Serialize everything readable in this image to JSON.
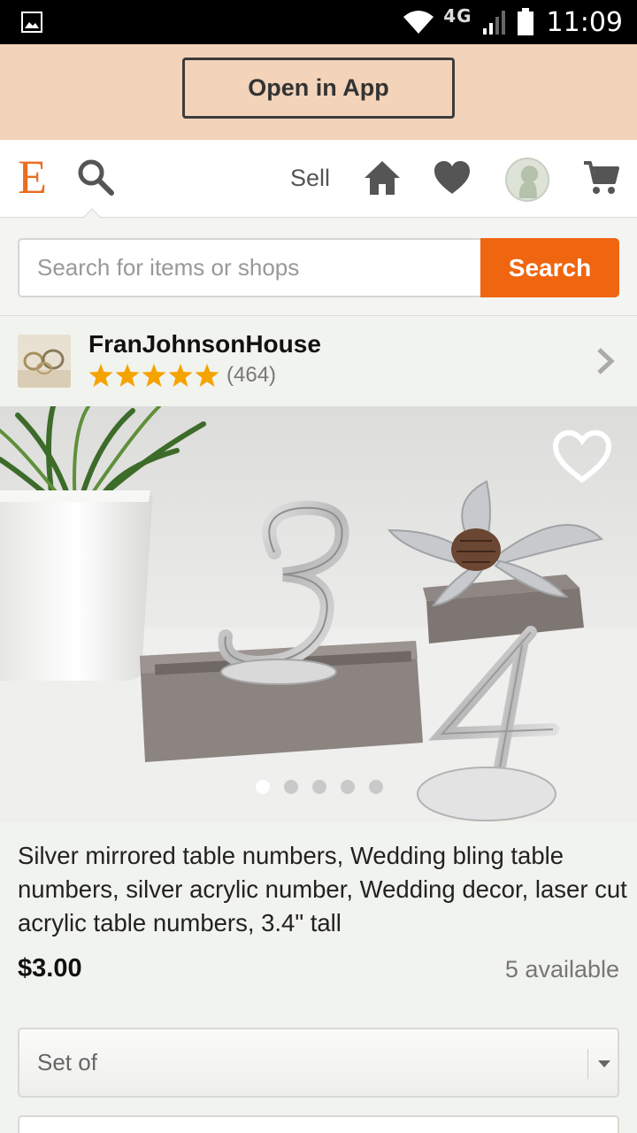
{
  "status_bar": {
    "network": "4G",
    "time": "11:09"
  },
  "banner": {
    "open_app_label": "Open in App"
  },
  "header": {
    "logo": "E",
    "sell_label": "Sell"
  },
  "search": {
    "placeholder": "Search for items or shops",
    "button_label": "Search"
  },
  "shop": {
    "name": "FranJohnsonHouse",
    "rating": 5,
    "review_count": "(464)"
  },
  "gallery": {
    "image_count": 5,
    "active_index": 0
  },
  "listing": {
    "title": "Silver mirrored table numbers, Wedding bling table numbers, silver acrylic number, Wedding decor, laser cut acrylic table numbers, 3.4\" tall",
    "price": "$3.00",
    "availability": "5 available",
    "variant_selected": "Set of"
  },
  "colors": {
    "brand": "#eb6d20",
    "search_button": "#f0650f",
    "banner_bg": "#f3d3b9",
    "star": "#f5a300"
  },
  "icons": [
    "gallery-icon",
    "wifi-icon",
    "signal-icon",
    "battery-icon",
    "search-icon",
    "home-icon",
    "heart-icon",
    "avatar-icon",
    "cart-icon",
    "star-icon",
    "chevron-right-icon",
    "favorite-heart-icon",
    "dropdown-arrow-icon"
  ]
}
